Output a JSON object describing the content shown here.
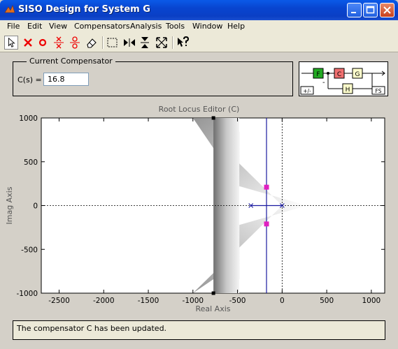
{
  "window": {
    "title": "SISO Design for System G"
  },
  "menu": [
    "File",
    "Edit",
    "View",
    "Compensators",
    "Analysis",
    "Tools",
    "Window",
    "Help"
  ],
  "toolbar": [
    "select-arrow-icon",
    "add-real-pole-icon",
    "add-real-zero-icon",
    "add-complex-pole-icon",
    "add-complex-zero-icon",
    "eraser-icon",
    "zoom-box-icon",
    "zoom-x-icon",
    "zoom-y-icon",
    "zoom-extents-icon",
    "help-pointer-icon"
  ],
  "compensator": {
    "legend": "Current Compensator",
    "label": "C(s) =",
    "value": "16.8"
  },
  "block_diagram": {
    "blocks": [
      "F",
      "C",
      "G",
      "H"
    ],
    "sign": "-",
    "feedback_button": "+/-",
    "config_button": "FS"
  },
  "editor": {
    "title": "Root Locus Editor (C)"
  },
  "chart_data": {
    "type": "scatter",
    "title": "Root Locus Editor (C)",
    "xlabel": "Real Axis",
    "ylabel": "Imag Axis",
    "xlim": [
      -2700,
      1150
    ],
    "ylim": [
      -1000,
      1000
    ],
    "xticks": [
      -2500,
      -2000,
      -1500,
      -1000,
      -500,
      0,
      500,
      1000
    ],
    "yticks": [
      -1000,
      -500,
      0,
      500,
      1000
    ],
    "grid": false,
    "open_loop_poles": [
      {
        "x": -350,
        "y": 0
      },
      {
        "x": 0,
        "y": 0
      }
    ],
    "closed_loop_poles": [
      {
        "x": -175,
        "y": 210
      },
      {
        "x": -175,
        "y": -210
      }
    ],
    "locus_branch": {
      "x": -175
    },
    "limit_markers": [
      {
        "x": -770,
        "y": 1000
      },
      {
        "x": -770,
        "y": -1000
      }
    ]
  },
  "status": {
    "text": "The compensator C has been updated."
  }
}
